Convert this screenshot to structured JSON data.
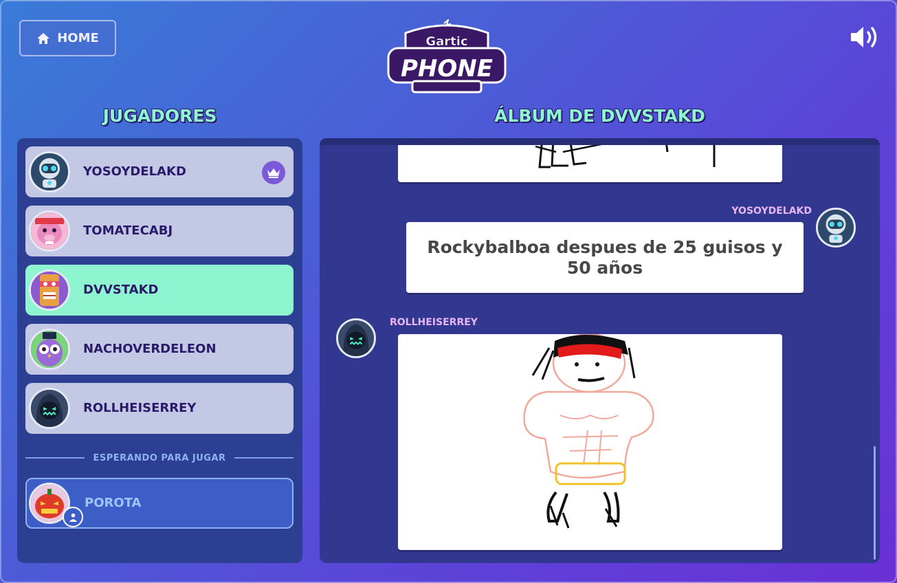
{
  "header": {
    "home_label": "HOME",
    "logo_top": "Gartic",
    "logo_bottom": "PHONE",
    "icons": {
      "home": "home-icon",
      "sound": "volume-icon"
    }
  },
  "players": {
    "title": "JUGADORES",
    "items": [
      {
        "name": "YOSOYDELAKD",
        "avatar": "robot-avatar",
        "host": true,
        "active": false
      },
      {
        "name": "TOMATECABJ",
        "avatar": "pig-avatar",
        "host": false,
        "active": false
      },
      {
        "name": "DVVSTAKD",
        "avatar": "tiki-avatar",
        "host": false,
        "active": true
      },
      {
        "name": "NACHOVERDELEON",
        "avatar": "owl-avatar",
        "host": false,
        "active": false
      },
      {
        "name": "ROLLHEISERREY",
        "avatar": "reaper-avatar",
        "host": false,
        "active": false
      }
    ],
    "waiting_label": "ESPERANDO PARA JUGAR",
    "waiting": [
      {
        "name": "POROTA",
        "avatar": "pumpkin-avatar"
      }
    ]
  },
  "album": {
    "title": "ÁLBUM DE DVVSTAKD",
    "entries": [
      {
        "type": "drawing",
        "author": "",
        "content": "partial-drawing"
      },
      {
        "type": "text",
        "author": "YOSOYDELAKD",
        "text": "Rockybalboa despues de 25 guisos y 50 años"
      },
      {
        "type": "drawing",
        "author": "ROLLHEISERREY",
        "content": "boxer-drawing"
      }
    ]
  },
  "colors": {
    "accent": "#8ff5d0",
    "panel": "#2c3f93",
    "player_card": "#c3c8e4",
    "text_dark": "#2a1a6a",
    "author_pink": "#e8b5f5"
  }
}
